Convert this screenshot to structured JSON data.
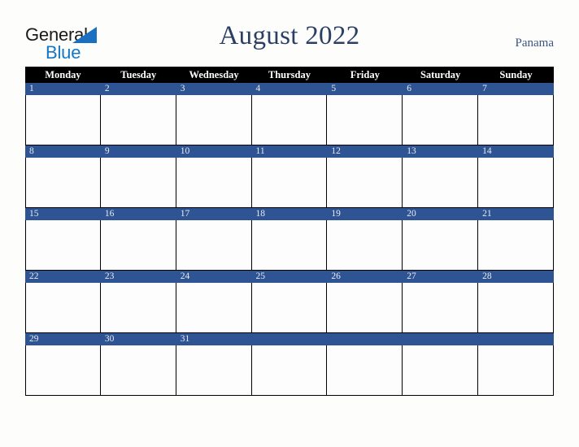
{
  "brand": {
    "name_part1": "General",
    "name_part2": "Blue",
    "triangle_icon": "triangle-icon",
    "color_dark": "#1a1a1a",
    "color_blue": "#1577c4"
  },
  "header": {
    "title": "August 2022",
    "month": "August",
    "year": "2022",
    "locale": "Panama",
    "title_color": "#2b3e63",
    "locale_color": "#3c5483"
  },
  "calendar": {
    "weekday_headers": [
      "Monday",
      "Tuesday",
      "Wednesday",
      "Thursday",
      "Friday",
      "Saturday",
      "Sunday"
    ],
    "header_bg": "#000000",
    "header_fg": "#ffffff",
    "date_bar_bg": "#2e5494",
    "date_bar_fg": "#e9ecf3",
    "cell_bg": "#fdfdfd",
    "border_color": "#000000",
    "weeks": [
      {
        "days": [
          {
            "date": "1",
            "empty": false
          },
          {
            "date": "2",
            "empty": false
          },
          {
            "date": "3",
            "empty": false
          },
          {
            "date": "4",
            "empty": false
          },
          {
            "date": "5",
            "empty": false
          },
          {
            "date": "6",
            "empty": false
          },
          {
            "date": "7",
            "empty": false
          }
        ]
      },
      {
        "days": [
          {
            "date": "8",
            "empty": false
          },
          {
            "date": "9",
            "empty": false
          },
          {
            "date": "10",
            "empty": false
          },
          {
            "date": "11",
            "empty": false
          },
          {
            "date": "12",
            "empty": false
          },
          {
            "date": "13",
            "empty": false
          },
          {
            "date": "14",
            "empty": false
          }
        ]
      },
      {
        "days": [
          {
            "date": "15",
            "empty": false
          },
          {
            "date": "16",
            "empty": false
          },
          {
            "date": "17",
            "empty": false
          },
          {
            "date": "18",
            "empty": false
          },
          {
            "date": "19",
            "empty": false
          },
          {
            "date": "20",
            "empty": false
          },
          {
            "date": "21",
            "empty": false
          }
        ]
      },
      {
        "days": [
          {
            "date": "22",
            "empty": false
          },
          {
            "date": "23",
            "empty": false
          },
          {
            "date": "24",
            "empty": false
          },
          {
            "date": "25",
            "empty": false
          },
          {
            "date": "26",
            "empty": false
          },
          {
            "date": "27",
            "empty": false
          },
          {
            "date": "28",
            "empty": false
          }
        ]
      },
      {
        "days": [
          {
            "date": "29",
            "empty": false
          },
          {
            "date": "30",
            "empty": false
          },
          {
            "date": "31",
            "empty": false
          },
          {
            "date": "",
            "empty": true
          },
          {
            "date": "",
            "empty": true
          },
          {
            "date": "",
            "empty": true
          },
          {
            "date": "",
            "empty": true
          }
        ]
      }
    ]
  }
}
